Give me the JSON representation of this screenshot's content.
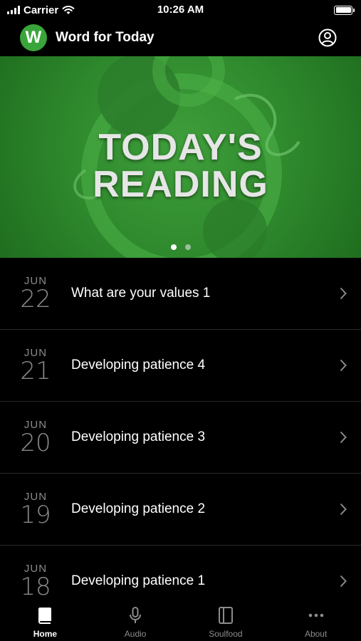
{
  "status_bar": {
    "carrier": "Carrier",
    "time": "10:26 AM"
  },
  "header": {
    "logo_letter": "W",
    "title": "Word for Today",
    "profile_icon": "person-circle-icon"
  },
  "banner": {
    "line1": "TODAY'S",
    "line2": "READING",
    "page_count": 2,
    "current_page": 1,
    "accent_color": "#2f8a2d"
  },
  "readings": [
    {
      "month": "JUN",
      "day": "22",
      "title": "What are your values 1"
    },
    {
      "month": "JUN",
      "day": "21",
      "title": "Developing patience 4"
    },
    {
      "month": "JUN",
      "day": "20",
      "title": "Developing patience 3"
    },
    {
      "month": "JUN",
      "day": "19",
      "title": "Developing patience 2"
    },
    {
      "month": "JUN",
      "day": "18",
      "title": "Developing patience 1"
    }
  ],
  "tabs": [
    {
      "label": "Home",
      "icon": "book-icon",
      "active": true
    },
    {
      "label": "Audio",
      "icon": "microphone-icon",
      "active": false
    },
    {
      "label": "Soulfood",
      "icon": "book-outline-icon",
      "active": false
    },
    {
      "label": "About",
      "icon": "more-dots-icon",
      "active": false
    }
  ]
}
